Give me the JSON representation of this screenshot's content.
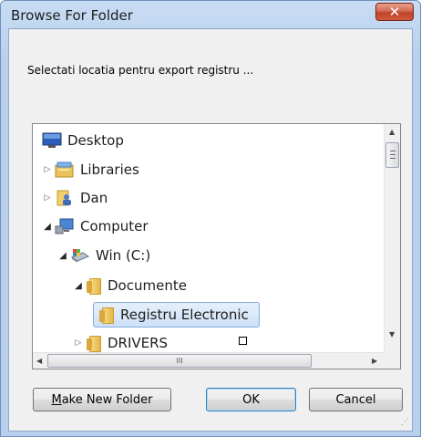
{
  "window": {
    "title": "Browse For Folder",
    "close_label": "✕"
  },
  "instruction": "Selectati locatia pentru export registru ...",
  "tree": {
    "items": [
      {
        "label": "Desktop",
        "icon": "desktop-icon",
        "expander": "none"
      },
      {
        "label": "Libraries",
        "icon": "libraries-icon",
        "expander": "collapsed"
      },
      {
        "label": "Dan",
        "icon": "user-icon",
        "expander": "collapsed"
      },
      {
        "label": "Computer",
        "icon": "computer-icon",
        "expander": "expanded"
      },
      {
        "label": "Win (C:)",
        "icon": "drive-icon",
        "expander": "expanded"
      },
      {
        "label": "Documente",
        "icon": "folder-icon",
        "expander": "expanded"
      },
      {
        "label": "Registru Electronic",
        "icon": "folder-icon",
        "expander": "none",
        "selected": true
      },
      {
        "label": "DRIVERS",
        "icon": "folder-icon",
        "expander": "collapsed"
      }
    ],
    "hscroll_grip": "III"
  },
  "buttons": {
    "new_folder_mnemonic": "M",
    "new_folder_rest": "ake New Folder",
    "ok": "OK",
    "cancel": "Cancel"
  },
  "colors": {
    "selection_fill": "#cde0f7",
    "selection_border": "#84acdd",
    "close_button": "#c0432a"
  }
}
